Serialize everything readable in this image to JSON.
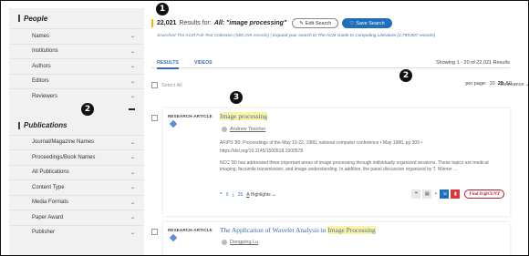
{
  "sidebar": {
    "people_heading": "People",
    "people_items": [
      "Names",
      "Institutions",
      "Authors",
      "Editors",
      "Reviewers"
    ],
    "publications_heading": "Publications",
    "publication_items": [
      "Journal/Magazine Names",
      "Proceedings/Book Names",
      "All Publications",
      "Content Type",
      "Media Formats",
      "Paper Award",
      "Publisher"
    ]
  },
  "markers": {
    "m1": "1",
    "m2": "2",
    "m3": "3"
  },
  "summary": {
    "count": "22,021",
    "results_for": "Results for:",
    "query": "All: \"image processing\"",
    "edit_search": "Edit Search",
    "save_search": "Save Search",
    "searched_text": "Searched The ACM Full-Text Collection (588,259 records)",
    "separator": " | ",
    "expand_text": "Expand your search to The ACM Guide to Computing Literature (2,799,807 records)"
  },
  "tabs": [
    "RESULTS",
    "VIDEOS"
  ],
  "showing": "Showing 1 - 20 of 22,021 Results",
  "select_all": "Select All",
  "per_page": {
    "label": "per page:",
    "options": [
      "10",
      "20",
      "50"
    ],
    "selected": "20"
  },
  "sort": "Relevance",
  "results": [
    {
      "type": "RESEARCH-ARTICLE",
      "title_hl": "Image processing",
      "author": "Andrew Tescher",
      "pubinfo": "AFIPS '80: Proceedings of the May 19-22, 1980, national computer conference • May 1980, pp 309 • https://doi.org/10.1145/1500518.1500578",
      "abstract": "NCC '80 has addressed three important areas of image processing through individually organized sessions. These topics are medical imaging, facsimile transmission, and image understanding. In addition, the panel discussion organized by T. Wiener ...",
      "citations": "0",
      "downloads": "26",
      "highlights": "Highlights",
      "find_it": "Find It @CUNY"
    },
    {
      "type": "RESEARCH-ARTICLE",
      "title_prefix": "The Application of Wavelet Analysis in ",
      "title_hl": "Image Processing",
      "author": "Dongping Lu"
    }
  ],
  "icons": [
    "edit-icon",
    "heart-icon",
    "chevron-down-icon",
    "diamond-icon",
    "user-icon",
    "quote-icon",
    "bookmark-icon",
    "share-icon",
    "pdf-icon",
    "citation-icon",
    "download-icon"
  ],
  "colors": {
    "accent": "#3a6db5",
    "save_button": "#1f6fba",
    "highlight": "#fff3a0",
    "count_bar": "#f4b400",
    "sidebar": "#f1f1f1"
  }
}
